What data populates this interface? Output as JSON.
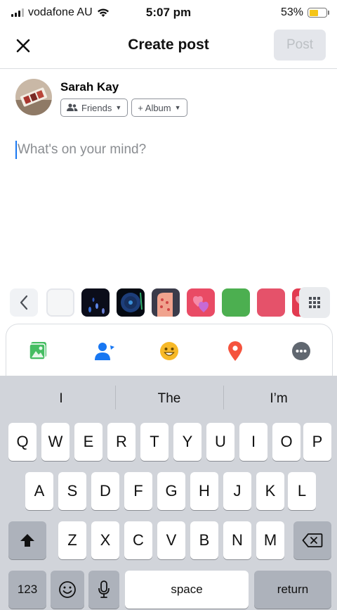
{
  "status_bar": {
    "carrier": "vodafone AU",
    "time": "5:07 pm",
    "battery": "53%",
    "battery_level": 0.53
  },
  "nav": {
    "close_icon": "close-icon",
    "title": "Create post",
    "post_label": "Post"
  },
  "author": {
    "name": "Sarah Kay",
    "audience_label": "Friends",
    "album_label": "+ Album"
  },
  "composer": {
    "placeholder": "What's on your mind?"
  },
  "backgrounds": {
    "colors": [
      "#f5f6f7",
      "#0b0d1a",
      "#050a12",
      "#3a3b4a",
      "#e94b65",
      "#4caf50",
      "#e5526a",
      "#e23b50"
    ]
  },
  "tools": [
    "photo-icon",
    "tag-people-icon",
    "feeling-icon",
    "location-icon",
    "more-icon"
  ],
  "keyboard": {
    "suggestions": [
      "I",
      "The",
      "I’m"
    ],
    "row1": [
      "Q",
      "W",
      "E",
      "R",
      "T",
      "Y",
      "U",
      "I",
      "O",
      "P"
    ],
    "row2": [
      "A",
      "S",
      "D",
      "F",
      "G",
      "H",
      "J",
      "K",
      "L"
    ],
    "row3": [
      "Z",
      "X",
      "C",
      "V",
      "B",
      "N",
      "M"
    ],
    "numbers_label": "123",
    "space_label": "space",
    "return_label": "return"
  }
}
